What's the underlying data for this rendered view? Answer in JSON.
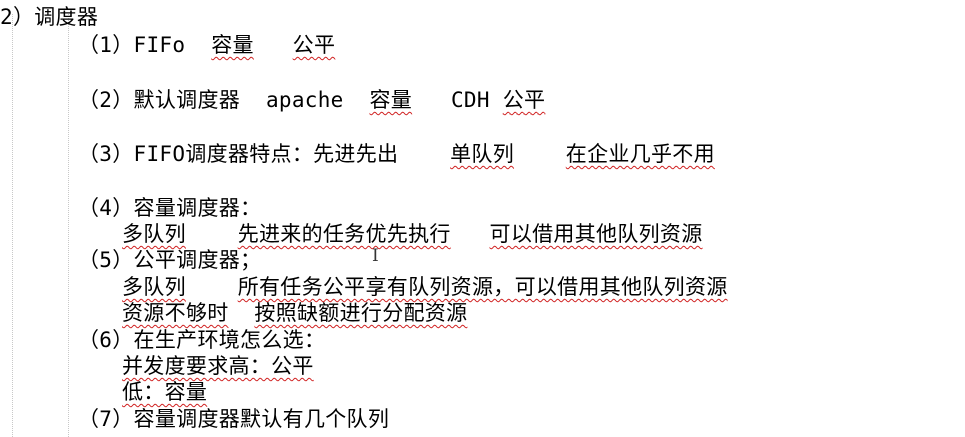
{
  "heading": "2）调度器",
  "items": {
    "i1": {
      "label": "（1）FIFo",
      "a": "容量",
      "b": "公平"
    },
    "i2": {
      "label": "（2）默认调度器",
      "a": "apache",
      "b": "容量",
      "c": "CDH",
      "d": "公平"
    },
    "i3": {
      "label": "（3）FIFO调度器特点：",
      "a": "先进先出",
      "b": "单队列",
      "c": "在企业几乎不用"
    },
    "i4": {
      "label": "（4）容量调度器：",
      "line1_a": "多队列",
      "line1_b": "先进来的任务优先执行",
      "line1_c": "可以借用其他队列资源"
    },
    "i5": {
      "label": "（5）公平调度器；",
      "line1_a": "多队列",
      "line1_b": "所有任务公平享有队列资源，可以借用其他队列资源",
      "line2_a": "资源不够时",
      "line2_b": "按照缺额进行分配资源"
    },
    "i6": {
      "label": "（6）在生产环境怎么选：",
      "line1": "并发度要求高：公平",
      "line2": "低：容量"
    },
    "i7": {
      "label": "（7）容量调度器默认有几个队列"
    }
  },
  "cursor_glyph": "I"
}
